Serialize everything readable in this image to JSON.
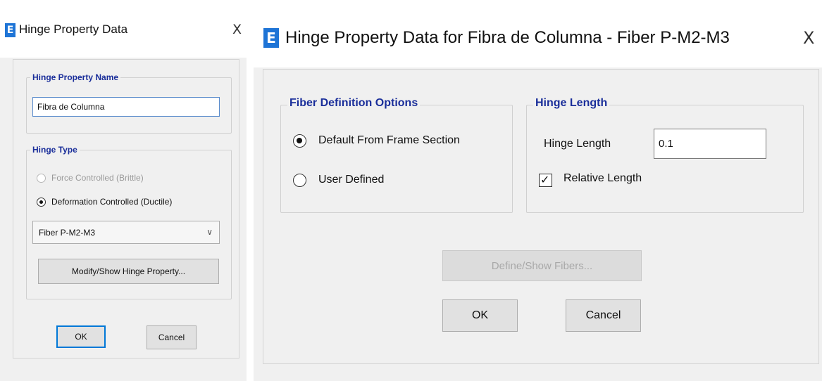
{
  "left_dialog": {
    "title": "Hinge Property Data",
    "close_glyph": "X",
    "name_group": {
      "legend": "Hinge Property Name",
      "value": "Fibra de Columna"
    },
    "type_group": {
      "legend": "Hinge Type",
      "option_force": "Force Controlled  (Brittle)",
      "option_deformation": "Deformation Controlled  (Ductile)",
      "selected": "Deformation Controlled  (Ductile)",
      "dropdown_value": "Fiber P-M2-M3",
      "modify_button": "Modify/Show Hinge Property..."
    },
    "ok_button": "OK",
    "cancel_button": "Cancel"
  },
  "right_dialog": {
    "title": "Hinge Property Data for Fibra de Columna - Fiber P-M2-M3",
    "close_glyph": "X",
    "fiber_group": {
      "legend": "Fiber Definition Options",
      "option_default": "Default From Frame Section",
      "option_user": "User Defined",
      "selected": "Default From Frame Section"
    },
    "length_group": {
      "legend": "Hinge Length",
      "length_label": "Hinge Length",
      "length_value": "0.1",
      "relative_label": "Relative Length",
      "relative_checked": true
    },
    "define_fibers_button": "Define/Show Fibers...",
    "ok_button": "OK",
    "cancel_button": "Cancel"
  },
  "icons": {
    "app": "E",
    "chevron": "∨",
    "check": "✓"
  },
  "colors": {
    "accent_blue": "#1e74d6",
    "legend_text": "#1a2e9a",
    "default_button_border": "#0078d7"
  }
}
